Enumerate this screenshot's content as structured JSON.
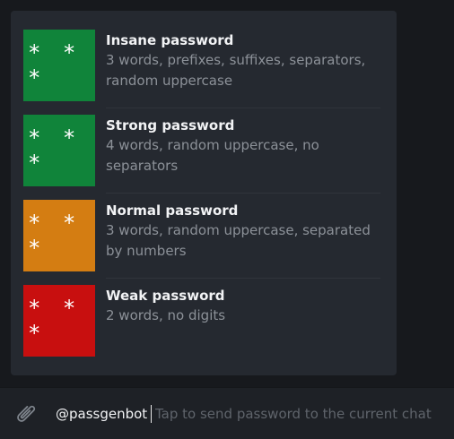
{
  "results": [
    {
      "title": "Insane password",
      "description": "3 words, prefixes, suffixes, separators, random uppercase",
      "thumb_text": "* * *",
      "thumb_color": "#10843a"
    },
    {
      "title": "Strong password",
      "description": "4 words, random uppercase, no separators",
      "thumb_text": "* * *",
      "thumb_color": "#10843a"
    },
    {
      "title": "Normal password",
      "description": "3 words, random uppercase, separated by numbers",
      "thumb_text": "* * *",
      "thumb_color": "#d47d12"
    },
    {
      "title": "Weak password",
      "description": "2 words, no digits",
      "thumb_text": "* * *",
      "thumb_color": "#c80f0f"
    }
  ],
  "composer": {
    "attach_icon": "paperclip-icon",
    "mention_text": "@passgenbot",
    "placeholder": "Tap to send password to the current chat"
  }
}
